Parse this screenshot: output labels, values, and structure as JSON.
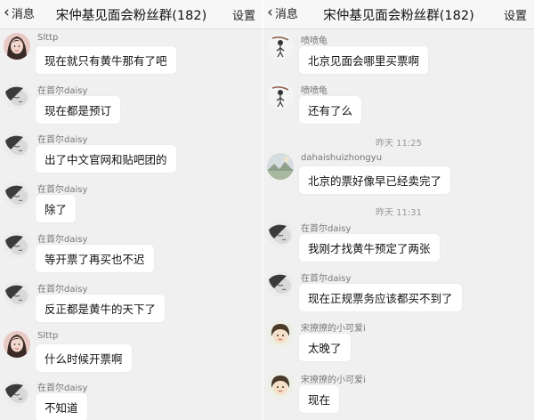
{
  "left": {
    "back_label": "消息",
    "title": "宋仲基见面会粉丝群(182)",
    "settings_label": "设置",
    "messages": [
      {
        "sender": "Slttp",
        "text": "现在就只有黄牛那有了吧",
        "avatar": "girl-photo-icon"
      },
      {
        "sender": "在首尔daisy",
        "text": "现在都是预订",
        "avatar": "sleeping-face-icon"
      },
      {
        "sender": "在首尔daisy",
        "text": "出了中文官网和贴吧团的",
        "avatar": "sleeping-face-icon"
      },
      {
        "sender": "在首尔daisy",
        "text": "除了",
        "avatar": "sleeping-face-icon"
      },
      {
        "sender": "在首尔daisy",
        "text": "等开票了再买也不迟",
        "avatar": "sleeping-face-icon"
      },
      {
        "sender": "在首尔daisy",
        "text": "反正都是黄牛的天下了",
        "avatar": "sleeping-face-icon"
      },
      {
        "sender": "Slttp",
        "text": "什么时候开票啊",
        "avatar": "girl-photo-icon"
      },
      {
        "sender": "在首尔daisy",
        "text": "不知道",
        "avatar": "sleeping-face-icon"
      }
    ]
  },
  "right": {
    "back_label": "消息",
    "title": "宋仲基见面会粉丝群(182)",
    "settings_label": "设置",
    "time1": "昨天 11:25",
    "time2": "昨天 11:31",
    "messages": [
      {
        "sender": "喷喷龟",
        "text": "北京见面会哪里买票啊",
        "avatar": "person-sketch-icon"
      },
      {
        "sender": "喷喷龟",
        "text": "还有了么",
        "avatar": "person-sketch-icon"
      },
      {
        "sender": "dahaishuizhongyu",
        "text": "北京的票好像早已经卖完了",
        "avatar": "landscape-photo-icon"
      },
      {
        "sender": "在首尔daisy",
        "text": "我刚才找黄牛预定了两张",
        "avatar": "sleeping-face-icon"
      },
      {
        "sender": "在首尔daisy",
        "text": "现在正规票务应该都买不到了",
        "avatar": "sleeping-face-icon"
      },
      {
        "sender": "宋撩撩的小可爱i",
        "text": "太晚了",
        "avatar": "cartoon-girl-icon"
      },
      {
        "sender": "宋撩撩的小可爱i",
        "text": "现在",
        "avatar": "cartoon-girl-icon"
      }
    ]
  }
}
